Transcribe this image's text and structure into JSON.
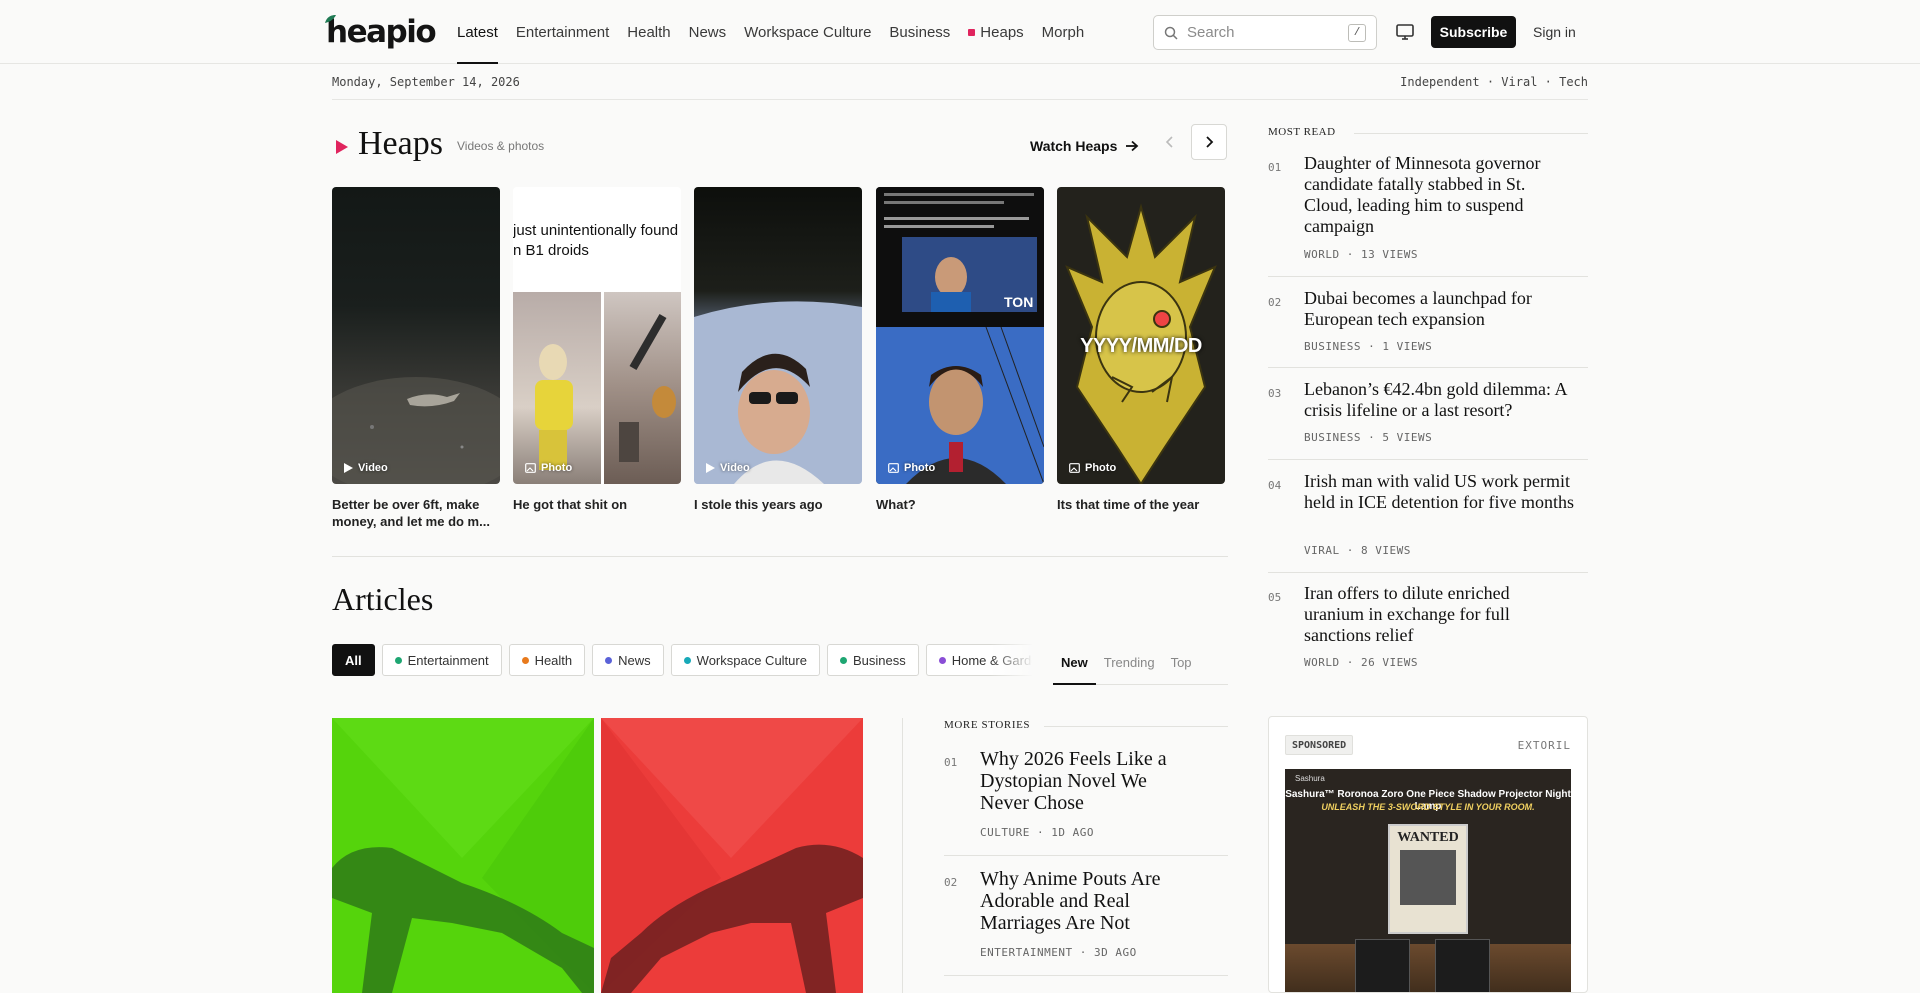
{
  "header": {
    "logo": "heapio",
    "nav": [
      {
        "label": "Latest",
        "active": true
      },
      {
        "label": "Entertainment"
      },
      {
        "label": "Health"
      },
      {
        "label": "News"
      },
      {
        "label": "Workspace Culture"
      },
      {
        "label": "Business"
      },
      {
        "label": "Heaps",
        "marker": true
      },
      {
        "label": "Morph"
      }
    ],
    "search_placeholder": "Search",
    "search_shortcut": "/",
    "subscribe_label": "Subscribe",
    "signin_label": "Sign in"
  },
  "dateline": {
    "date": "Monday, September 14, 2026",
    "tagline": "Independent · Viral · Tech"
  },
  "heaps": {
    "title": "Heaps",
    "subtitle": "Videos & photos",
    "watch_label": "Watch Heaps",
    "cards": [
      {
        "type": "Video",
        "caption": "Better be over 6ft, make money, and let me do m..."
      },
      {
        "type": "Photo",
        "caption": "He got that shit on",
        "overlay_text": "just unintentionally found\nn B1 droids"
      },
      {
        "type": "Video",
        "caption": "I stole this years ago"
      },
      {
        "type": "Photo",
        "caption": "What?"
      },
      {
        "type": "Photo",
        "caption": "Its that time of the year",
        "overlay_text": "YYYY/MM/DD"
      }
    ]
  },
  "articles": {
    "title": "Articles",
    "chips": [
      {
        "label": "All",
        "active": true
      },
      {
        "label": "Entertainment",
        "color": "#1ea672"
      },
      {
        "label": "Health",
        "color": "#e87a1c"
      },
      {
        "label": "News",
        "color": "#5a62d8"
      },
      {
        "label": "Workspace Culture",
        "color": "#17a9b8"
      },
      {
        "label": "Business",
        "color": "#1ea672"
      },
      {
        "label": "Home & Garden",
        "color": "#8a4ed6"
      }
    ],
    "sort_tabs": [
      {
        "label": "New",
        "active": true
      },
      {
        "label": "Trending"
      },
      {
        "label": "Top"
      }
    ],
    "more_stories_label": "More stories",
    "more_stories": [
      {
        "num": "01",
        "title": "Why 2026 Feels Like a Dystopian Novel We Never Chose",
        "meta": "CULTURE · 1D AGO"
      },
      {
        "num": "02",
        "title": "Why Anime Pouts Are Adorable and Real Marriages Are Not",
        "meta": "ENTERTAINMENT · 3D AGO"
      }
    ]
  },
  "most_read": {
    "label": "MOST READ",
    "items": [
      {
        "num": "01",
        "title": "Daughter of Minnesota governor candidate fatally stabbed in St. Cloud, leading him to suspend campaign",
        "meta": "WORLD · 13 VIEWS"
      },
      {
        "num": "02",
        "title": "Dubai becomes a launchpad for European tech expansion",
        "meta": "BUSINESS · 1 VIEWS"
      },
      {
        "num": "03",
        "title": "Lebanon’s €42.4bn gold dilemma: A crisis lifeline or a last resort?",
        "meta": "BUSINESS · 5 VIEWS"
      },
      {
        "num": "04",
        "title": "Irish man with valid US work permit held in ICE detention for five months",
        "meta": "VIRAL · 8 VIEWS"
      },
      {
        "num": "05",
        "title": "Iran offers to dilute enriched uranium in exchange for full sanctions relief",
        "meta": "WORLD · 26 VIEWS"
      }
    ]
  },
  "ad": {
    "badge": "SPONSORED",
    "brand": "EXTORIL",
    "image_brand": "Sashura",
    "headline": "Sashura™ Roronoa Zoro One Piece Shadow Projector Night Lamp",
    "tagline": "UNLEASH THE 3-SWORD STYLE IN YOUR ROOM.",
    "poster": "WANTED"
  },
  "colors": {
    "heaps_accent": "#e0245e",
    "hero_left": "#55d40c",
    "hero_right": "#ec3c3a"
  }
}
